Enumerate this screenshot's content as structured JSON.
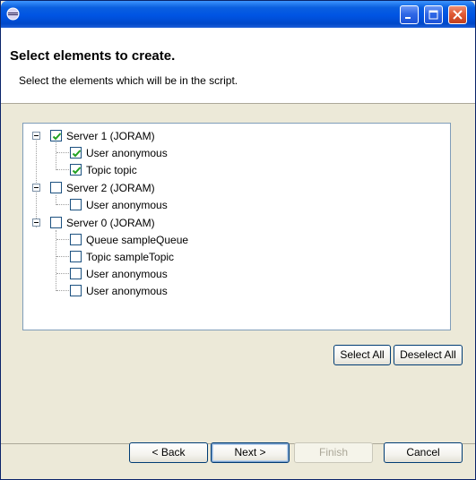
{
  "window": {
    "title": "",
    "buttons": [
      "minimize",
      "maximize",
      "close"
    ]
  },
  "header": {
    "title": "Select elements to create.",
    "description": "Select the elements which will be in the script."
  },
  "tree": {
    "servers": [
      {
        "label": "Server 1 (JORAM)",
        "checked": true,
        "children": [
          {
            "label": "User anonymous",
            "checked": true
          },
          {
            "label": "Topic topic",
            "checked": true
          }
        ]
      },
      {
        "label": "Server 2 (JORAM)",
        "checked": false,
        "children": [
          {
            "label": "User anonymous",
            "checked": false
          }
        ]
      },
      {
        "label": "Server 0 (JORAM)",
        "checked": false,
        "children": [
          {
            "label": "Queue sampleQueue",
            "checked": false
          },
          {
            "label": "Topic sampleTopic",
            "checked": false
          },
          {
            "label": "User anonymous",
            "checked": false
          },
          {
            "label": "User anonymous",
            "checked": false
          }
        ]
      }
    ]
  },
  "selection_buttons": {
    "select_all": "Select All",
    "deselect_all": "Deselect All"
  },
  "wizard_buttons": {
    "back": "< Back",
    "next": "Next >",
    "finish": "Finish",
    "cancel": "Cancel"
  },
  "colors": {
    "titlebar": "#0054e3",
    "check": "#21a121",
    "close_button": "#e05a35"
  }
}
